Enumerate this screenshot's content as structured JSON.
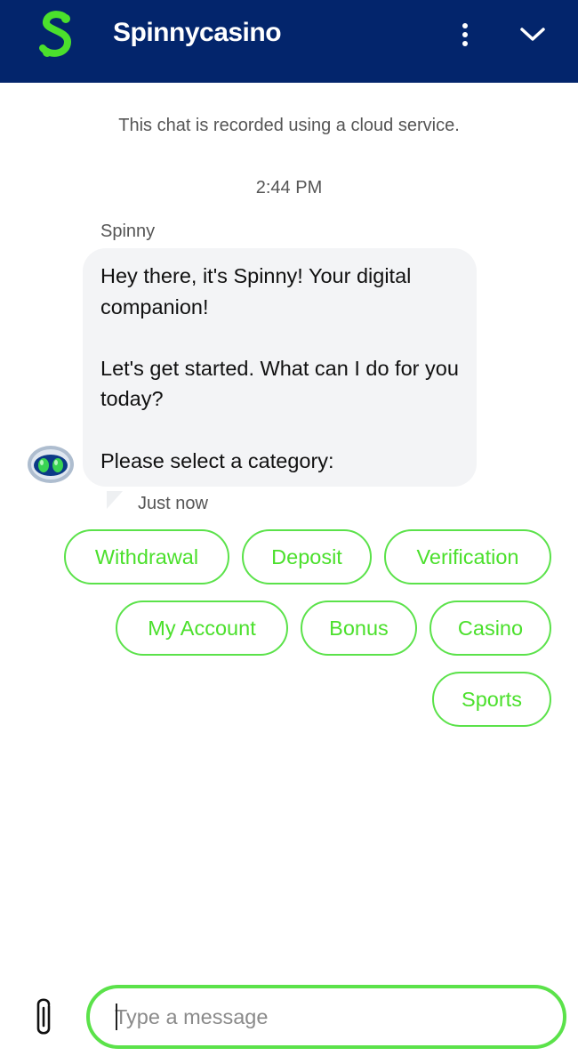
{
  "header": {
    "title": "Spinnycasino",
    "logo_icon": "spinny-s-logo-icon",
    "menu_icon": "vertical-ellipsis-icon",
    "collapse_icon": "chevron-down-icon",
    "background_color": "#03256c",
    "logo_color": "#4be02c"
  },
  "chat": {
    "notice": "This chat is recorded using a cloud service.",
    "timestamp": "2:44 PM",
    "message": {
      "sender": "Spinny",
      "lines": [
        "Hey there, it's Spinny! Your digital companion!",
        "Let's get started. What can I do for you today?",
        "Please select a category:"
      ],
      "status": "Just now",
      "avatar_icon": "robot-avatar-icon",
      "bubble_color": "#f3f4f6"
    },
    "quick_replies": [
      "Withdrawal",
      "Deposit",
      "Verification",
      "My Account",
      "Bonus",
      "Casino",
      "Sports"
    ]
  },
  "composer": {
    "placeholder": "Type a message",
    "value": "",
    "attach_icon": "paperclip-icon",
    "accent_color": "#5be24a"
  }
}
